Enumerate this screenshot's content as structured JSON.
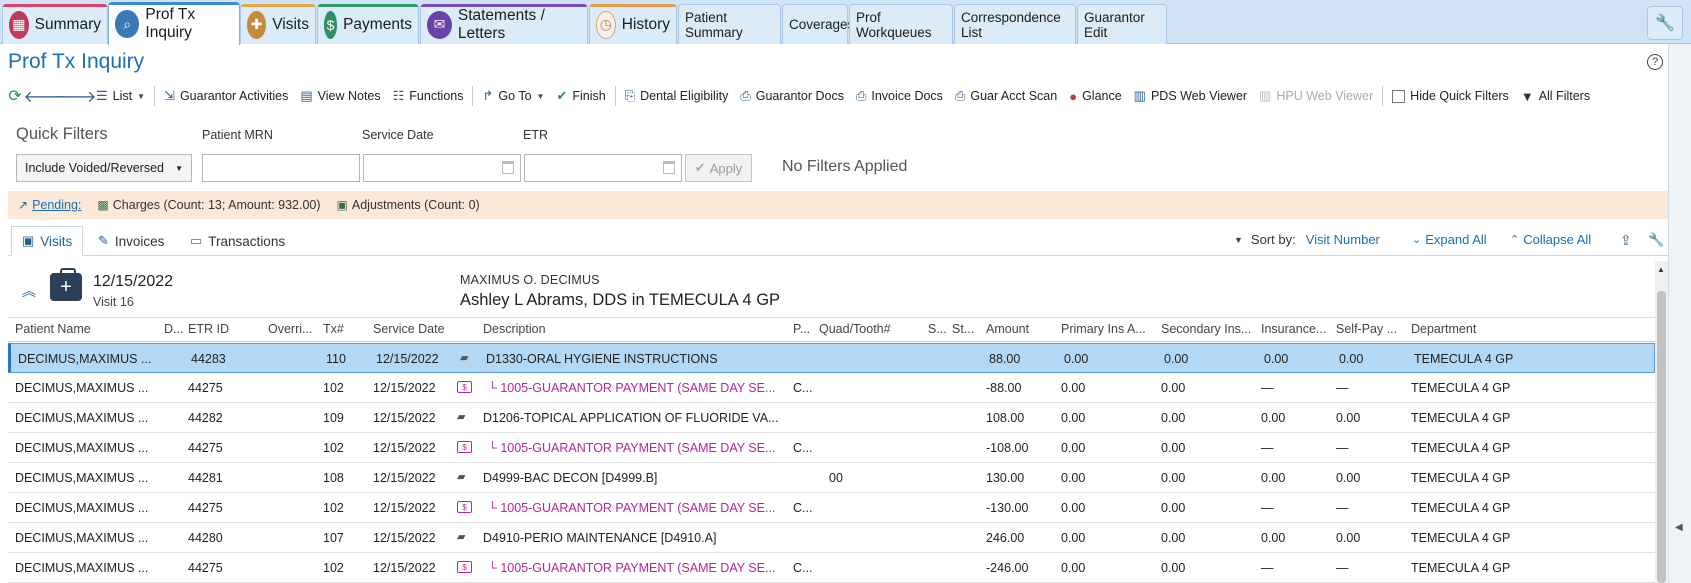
{
  "tabs": {
    "summary": "Summary",
    "prof_tx_inquiry": "Prof Tx Inquiry",
    "visits": "Visits",
    "payments": "Payments",
    "statements": "Statements / Letters",
    "history": "History",
    "patient_summary": "Patient Summary",
    "coverages": "Coverages",
    "prof_workqueues": "Prof Workqueues",
    "correspondence_list": "Correspondence List",
    "guarantor_edit": "Guarantor Edit"
  },
  "page": {
    "title": "Prof Tx Inquiry"
  },
  "toolbar": {
    "list": "List",
    "guarantor_activities": "Guarantor Activities",
    "view_notes": "View Notes",
    "functions": "Functions",
    "go_to": "Go To",
    "finish": "Finish",
    "dental_eligibility": "Dental Eligibility",
    "guarantor_docs": "Guarantor Docs",
    "invoice_docs": "Invoice Docs",
    "guar_acct_scan": "Guar Acct Scan",
    "glance": "Glance",
    "pds_web_viewer": "PDS Web Viewer",
    "hpu_web_viewer": "HPU Web Viewer",
    "hide_quick_filters": "Hide Quick Filters",
    "all_filters": "All Filters"
  },
  "quick_filters": {
    "title": "Quick Filters",
    "select_value": "Include Voided/Reversed",
    "patient_mrn_label": "Patient MRN",
    "service_date_label": "Service Date",
    "etr_label": "ETR",
    "apply": "Apply",
    "status": "No Filters Applied"
  },
  "pending": {
    "label": "Pending:",
    "charges": "Charges (Count: 13; Amount: 932.00)",
    "adjustments": "Adjustments (Count: 0)"
  },
  "subtabs": {
    "visits": "Visits",
    "invoices": "Invoices",
    "transactions": "Transactions"
  },
  "sort": {
    "label": "Sort by:",
    "value": "Visit Number",
    "expand_all": "Expand All",
    "collapse_all": "Collapse All"
  },
  "visit": {
    "date": "12/15/2022",
    "number": "Visit 16",
    "patient": "MAXIMUS O. DECIMUS",
    "provider": "Ashley L Abrams, DDS in TEMECULA 4 GP"
  },
  "columns": {
    "patient_name": "Patient Name",
    "d": "D...",
    "etr_id": "ETR ID",
    "override": "Overri...",
    "tx": "Tx#",
    "service_date": "Service Date",
    "description": "Description",
    "p": "P...",
    "quad_tooth": "Quad/Tooth#",
    "s": "S...",
    "st": "St...",
    "amount": "Amount",
    "primary_ins": "Primary Ins A...",
    "secondary_ins": "Secondary Ins...",
    "insurance": "Insurance...",
    "self_pay": "Self-Pay ...",
    "department": "Department"
  },
  "rows": [
    {
      "patient": "DECIMUS,MAXIMUS ...",
      "etr": "44283",
      "tx": "110",
      "date": "12/15/2022",
      "type": "charge",
      "desc": "D1330-ORAL HYGIENE INSTRUCTIONS",
      "p": "",
      "quad": "",
      "amount": "88.00",
      "primary": "0.00",
      "secondary": "0.00",
      "insurance": "0.00",
      "selfpay": "0.00",
      "dept": "TEMECULA 4 GP"
    },
    {
      "patient": "DECIMUS,MAXIMUS ...",
      "etr": "44275",
      "tx": "102",
      "date": "12/15/2022",
      "type": "pay",
      "desc": "└ 1005-GUARANTOR PAYMENT (SAME DAY SE...",
      "p": "C...",
      "quad": "",
      "amount": "-88.00",
      "primary": "0.00",
      "secondary": "0.00",
      "insurance": "—",
      "selfpay": "—",
      "dept": "TEMECULA 4 GP"
    },
    {
      "patient": "DECIMUS,MAXIMUS ...",
      "etr": "44282",
      "tx": "109",
      "date": "12/15/2022",
      "type": "charge",
      "desc": "D1206-TOPICAL APPLICATION OF FLUORIDE VA...",
      "p": "",
      "quad": "",
      "amount": "108.00",
      "primary": "0.00",
      "secondary": "0.00",
      "insurance": "0.00",
      "selfpay": "0.00",
      "dept": "TEMECULA 4 GP"
    },
    {
      "patient": "DECIMUS,MAXIMUS ...",
      "etr": "44275",
      "tx": "102",
      "date": "12/15/2022",
      "type": "pay",
      "desc": "└ 1005-GUARANTOR PAYMENT (SAME DAY SE...",
      "p": "C...",
      "quad": "",
      "amount": "-108.00",
      "primary": "0.00",
      "secondary": "0.00",
      "insurance": "—",
      "selfpay": "—",
      "dept": "TEMECULA 4 GP"
    },
    {
      "patient": "DECIMUS,MAXIMUS ...",
      "etr": "44281",
      "tx": "108",
      "date": "12/15/2022",
      "type": "charge",
      "desc": "D4999-BAC DECON [D4999.B]",
      "p": "",
      "quad": "00",
      "amount": "130.00",
      "primary": "0.00",
      "secondary": "0.00",
      "insurance": "0.00",
      "selfpay": "0.00",
      "dept": "TEMECULA 4 GP"
    },
    {
      "patient": "DECIMUS,MAXIMUS ...",
      "etr": "44275",
      "tx": "102",
      "date": "12/15/2022",
      "type": "pay",
      "desc": "└ 1005-GUARANTOR PAYMENT (SAME DAY SE...",
      "p": "C...",
      "quad": "",
      "amount": "-130.00",
      "primary": "0.00",
      "secondary": "0.00",
      "insurance": "—",
      "selfpay": "—",
      "dept": "TEMECULA 4 GP"
    },
    {
      "patient": "DECIMUS,MAXIMUS ...",
      "etr": "44280",
      "tx": "107",
      "date": "12/15/2022",
      "type": "charge",
      "desc": "D4910-PERIO MAINTENANCE [D4910.A]",
      "p": "",
      "quad": "",
      "amount": "246.00",
      "primary": "0.00",
      "secondary": "0.00",
      "insurance": "0.00",
      "selfpay": "0.00",
      "dept": "TEMECULA 4 GP"
    },
    {
      "patient": "DECIMUS,MAXIMUS ...",
      "etr": "44275",
      "tx": "102",
      "date": "12/15/2022",
      "type": "pay",
      "desc": "└ 1005-GUARANTOR PAYMENT (SAME DAY SE...",
      "p": "C...",
      "quad": "",
      "amount": "-246.00",
      "primary": "0.00",
      "secondary": "0.00",
      "insurance": "—",
      "selfpay": "—",
      "dept": "TEMECULA 4 GP"
    }
  ],
  "colors": {
    "accent": "#1a6fb5",
    "selected_row": "#b3d8f5",
    "payment_text": "#b3279b",
    "pending_bg": "#fbe8d6"
  }
}
